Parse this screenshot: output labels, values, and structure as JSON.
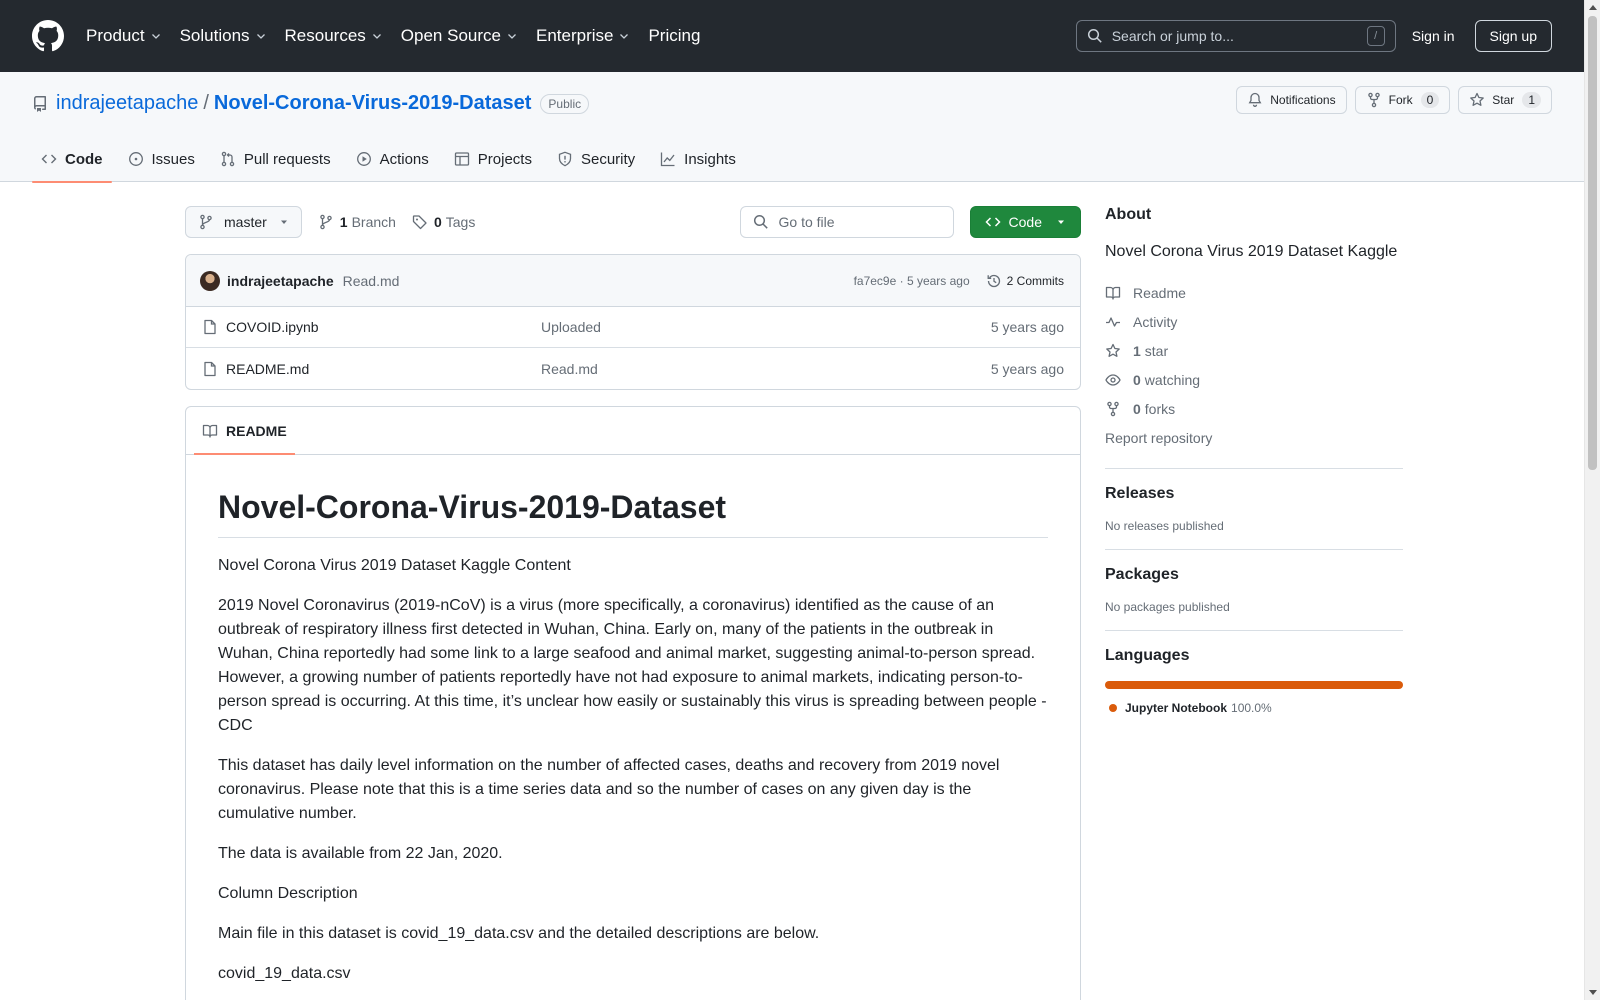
{
  "header": {
    "nav": [
      "Product",
      "Solutions",
      "Resources",
      "Open Source",
      "Enterprise",
      "Pricing"
    ],
    "search_placeholder": "Search or jump to...",
    "search_shortcut": "/",
    "sign_in": "Sign in",
    "sign_up": "Sign up"
  },
  "repo": {
    "owner": "indrajeetapache",
    "separator": "/",
    "name": "Novel-Corona-Virus-2019-Dataset",
    "visibility": "Public",
    "notifications_label": "Notifications",
    "fork_label": "Fork",
    "fork_count": "0",
    "star_label": "Star",
    "star_count": "1"
  },
  "tabs": [
    "Code",
    "Issues",
    "Pull requests",
    "Actions",
    "Projects",
    "Security",
    "Insights"
  ],
  "file_nav": {
    "branch": "master",
    "branch_count": "1",
    "branch_label": "Branch",
    "tag_count": "0",
    "tag_label": "Tags",
    "goto_placeholder": "Go to file",
    "code_button": "Code"
  },
  "latest_commit": {
    "author": "indrajeetapache",
    "message": "Read.md",
    "hash_time": "fa7ec9e · 5 years ago",
    "commits": "2 Commits"
  },
  "files": [
    {
      "name": "COVOID.ipynb",
      "message": "Uploaded",
      "age": "5 years ago"
    },
    {
      "name": "README.md",
      "message": "Read.md",
      "age": "5 years ago"
    }
  ],
  "readme": {
    "tab_label": "README",
    "title": "Novel-Corona-Virus-2019-Dataset",
    "paragraphs": [
      "Novel Corona Virus 2019 Dataset Kaggle Content",
      "2019 Novel Coronavirus (2019-nCoV) is a virus (more specifically, a coronavirus) identified as the cause of an outbreak of respiratory illness first detected in Wuhan, China. Early on, many of the patients in the outbreak in Wuhan, China reportedly had some link to a large seafood and animal market, suggesting animal-to-person spread. However, a growing number of patients reportedly have not had exposure to animal markets, indicating person-to-person spread is occurring. At this time, it’s unclear how easily or sustainably this virus is spreading between people - CDC",
      "This dataset has daily level information on the number of affected cases, deaths and recovery from 2019 novel coronavirus. Please note that this is a time series data and so the number of cases on any given day is the cumulative number.",
      "The data is available from 22 Jan, 2020.",
      "Column Description",
      "Main file in this dataset is covid_19_data.csv and the detailed descriptions are below.",
      "covid_19_data.csv"
    ]
  },
  "sidebar": {
    "about_title": "About",
    "about_desc": "Novel Corona Virus 2019 Dataset Kaggle",
    "readme": "Readme",
    "activity": "Activity",
    "stars_count": "1",
    "stars_label": "star",
    "watching_count": "0",
    "watching_label": "watching",
    "forks_count": "0",
    "forks_label": "forks",
    "report": "Report repository",
    "releases_title": "Releases",
    "releases_empty": "No releases published",
    "packages_title": "Packages",
    "packages_empty": "No packages published",
    "languages_title": "Languages",
    "language_name": "Jupyter Notebook",
    "language_pct": "100.0%",
    "language_color": "#da5b0b"
  }
}
